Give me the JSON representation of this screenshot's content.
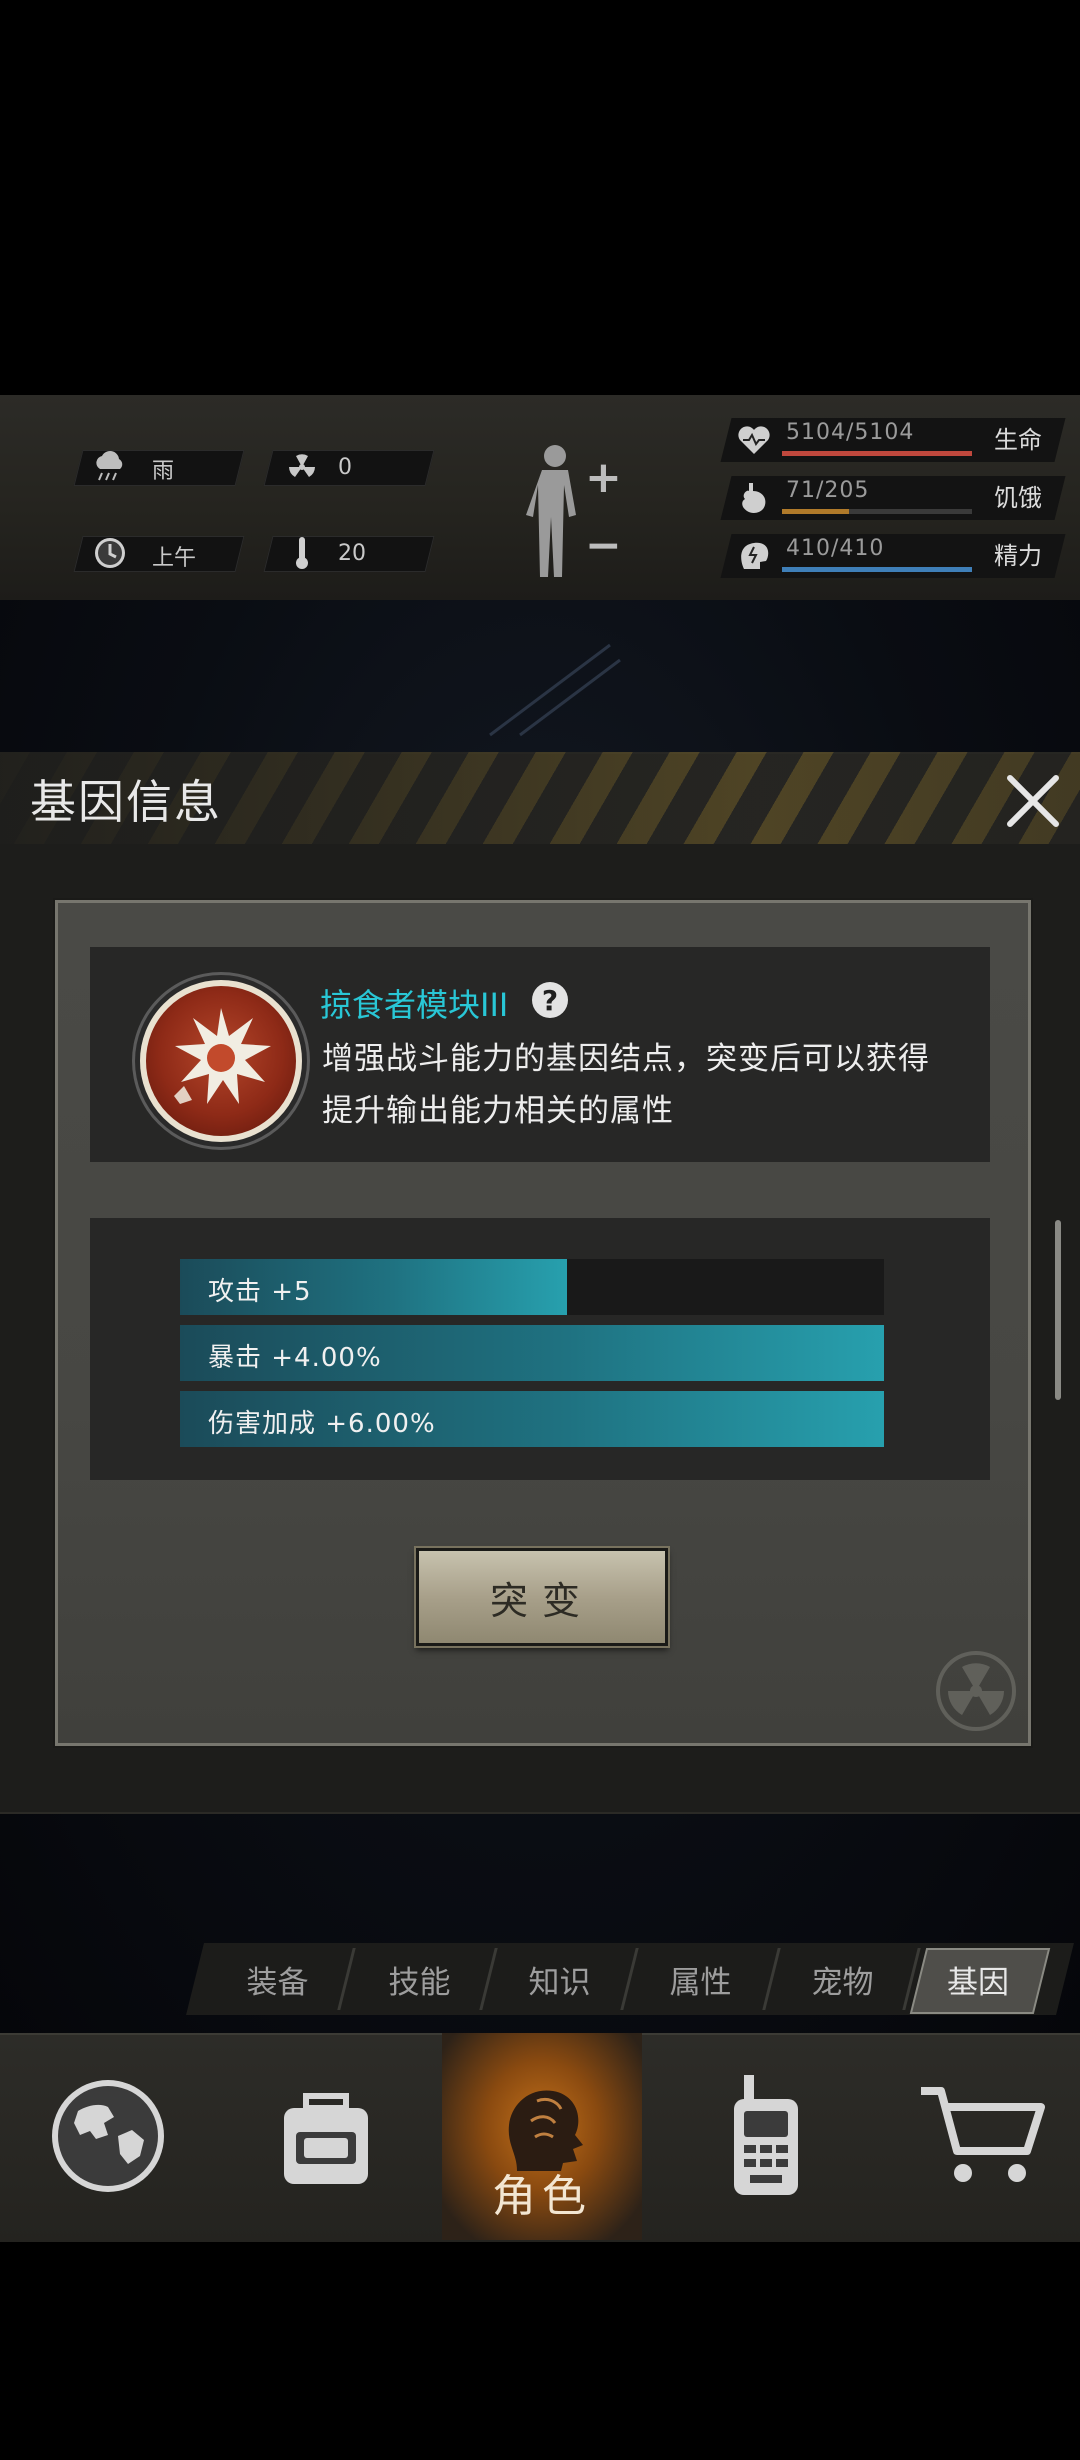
{
  "status": {
    "weather": {
      "icon": "rain-cloud-icon",
      "label": "雨"
    },
    "radiation": {
      "icon": "radiation-icon",
      "value": "0"
    },
    "time": {
      "icon": "clock-icon",
      "label": "上午"
    },
    "temperature": {
      "icon": "thermometer-icon",
      "value": "20"
    },
    "body": {
      "icon": "body-silhouette-icon",
      "plus": "+",
      "minus": "−"
    },
    "bars": [
      {
        "name": "health",
        "icon": "heart-icon",
        "value_text": "5104/5104",
        "label": "生命",
        "fraction": 1.0,
        "color": "#c0483d"
      },
      {
        "name": "hunger",
        "icon": "stomach-icon",
        "value_text": "71/205",
        "label": "饥饿",
        "fraction": 0.35,
        "color": "#b07a2a"
      },
      {
        "name": "energy",
        "icon": "brain-icon",
        "value_text": "410/410",
        "label": "精力",
        "fraction": 1.0,
        "color": "#3f7fb8"
      }
    ]
  },
  "dialog": {
    "title": "基因信息",
    "close_icon": "close-icon",
    "gene": {
      "icon": "gene-burst-icon",
      "name": "掠食者模块III",
      "help_icon": "help-icon",
      "help_glyph": "?",
      "description_line1": "增强战斗能力的基因结点，突变后可以获得",
      "description_line2": "提升输出能力相关的属性"
    },
    "stats": [
      {
        "label": "攻击 +5",
        "fraction": 0.55
      },
      {
        "label": "暴击 +4.00%",
        "fraction": 1.0
      },
      {
        "label": "伤害加成 +6.00%",
        "fraction": 1.0
      }
    ],
    "mutate_button": "突变"
  },
  "tabs": [
    {
      "label": "装备",
      "active": false
    },
    {
      "label": "技能",
      "active": false
    },
    {
      "label": "知识",
      "active": false
    },
    {
      "label": "属性",
      "active": false
    },
    {
      "label": "宠物",
      "active": false
    },
    {
      "label": "基因",
      "active": true
    }
  ],
  "nav": [
    {
      "name": "world",
      "icon": "globe-icon"
    },
    {
      "name": "backpack",
      "icon": "backpack-icon"
    },
    {
      "name": "role",
      "icon": "head-profile-icon",
      "label": "角色",
      "active": true
    },
    {
      "name": "radio",
      "icon": "walkie-talkie-icon"
    },
    {
      "name": "shop",
      "icon": "shopping-cart-icon"
    }
  ],
  "colors": {
    "accent_cyan": "#29c7d6",
    "stat_fill": "#1f7281",
    "active_nav": "#c2701a"
  }
}
